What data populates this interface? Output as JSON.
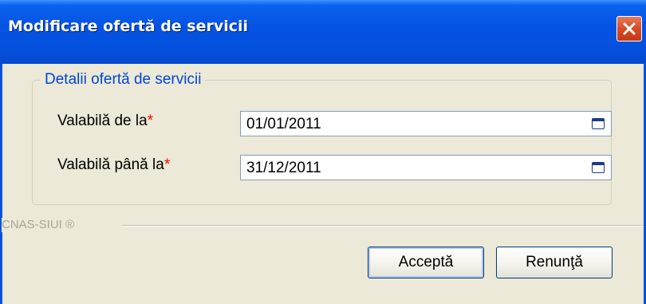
{
  "window": {
    "title": "Modificare ofertă de servicii",
    "close_icon": "close-icon"
  },
  "group": {
    "legend": "Detalii ofertă de servicii"
  },
  "fields": [
    {
      "label": "Valabilă de la",
      "required_mark": "*",
      "value": "01/01/2011",
      "icon": "calendar-icon"
    },
    {
      "label": "Valabilă până la",
      "required_mark": "*",
      "value": "31/12/2011",
      "icon": "calendar-icon"
    }
  ],
  "footer": {
    "label": "CNAS-SIUI ®"
  },
  "buttons": {
    "accept_label": "Acceptă",
    "cancel_label": "Renunţă"
  },
  "colors": {
    "title_bar": "#0552df",
    "dialog_background": "#ece9d8",
    "legend_text": "#0046d5",
    "required_mark": "#ff0000",
    "close_button": "#d94b25"
  }
}
